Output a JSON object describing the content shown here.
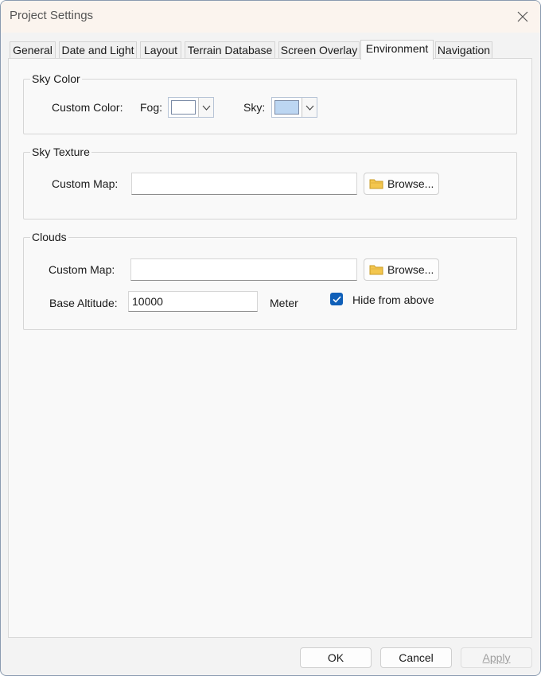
{
  "window": {
    "title": "Project Settings"
  },
  "tabs": [
    {
      "label": "General"
    },
    {
      "label": "Date and Light"
    },
    {
      "label": "Layout"
    },
    {
      "label": "Terrain Database"
    },
    {
      "label": "Screen Overlay"
    },
    {
      "label": "Environment",
      "active": true
    },
    {
      "label": "Navigation"
    }
  ],
  "sky_color": {
    "group_title": "Sky Color",
    "custom_color_label": "Custom Color:",
    "fog_label": "Fog:",
    "fog_color": "#ffffff",
    "sky_label": "Sky:",
    "sky_color": "#bcd6f2"
  },
  "sky_texture": {
    "group_title": "Sky Texture",
    "custom_map_label": "Custom Map:",
    "custom_map_value": "",
    "browse_label": "Browse..."
  },
  "clouds": {
    "group_title": "Clouds",
    "custom_map_label": "Custom Map:",
    "custom_map_value": "",
    "browse_label": "Browse...",
    "base_altitude_label": "Base Altitude:",
    "base_altitude_value": "10000",
    "unit_label": "Meter",
    "hide_from_above_label": "Hide from above",
    "hide_from_above_checked": true
  },
  "footer": {
    "ok_label": "OK",
    "cancel_label": "Cancel",
    "apply_label": "Apply"
  },
  "icons": {
    "close": "close-icon",
    "folder": "folder-icon",
    "chevron": "chevron-down-icon",
    "check": "checkmark-icon"
  }
}
